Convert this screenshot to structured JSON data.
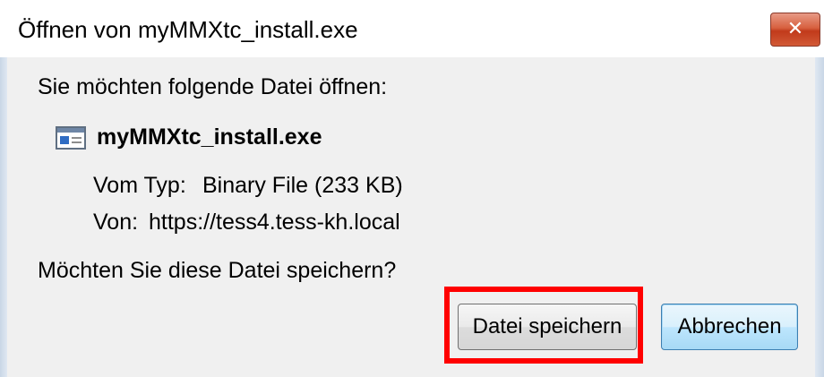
{
  "window": {
    "title": "Öffnen von myMMXtc_install.exe",
    "close_glyph": "✕"
  },
  "prompt": "Sie möchten folgende Datei öffnen:",
  "file": {
    "icon": "executable-file-icon",
    "name": "myMMXtc_install.exe",
    "type_label": "Vom Typ:",
    "type_value": "Binary File (233 KB)",
    "source_label": "Von:",
    "source_value": "https://tess4.tess-kh.local"
  },
  "question": "Möchten Sie diese Datei speichern?",
  "buttons": {
    "save_label": "Datei speichern",
    "cancel_label": "Abbrechen"
  },
  "colors": {
    "highlight": "#ff0000",
    "close_button": "#c13a1b",
    "default_button_border": "#3c7fb1"
  }
}
